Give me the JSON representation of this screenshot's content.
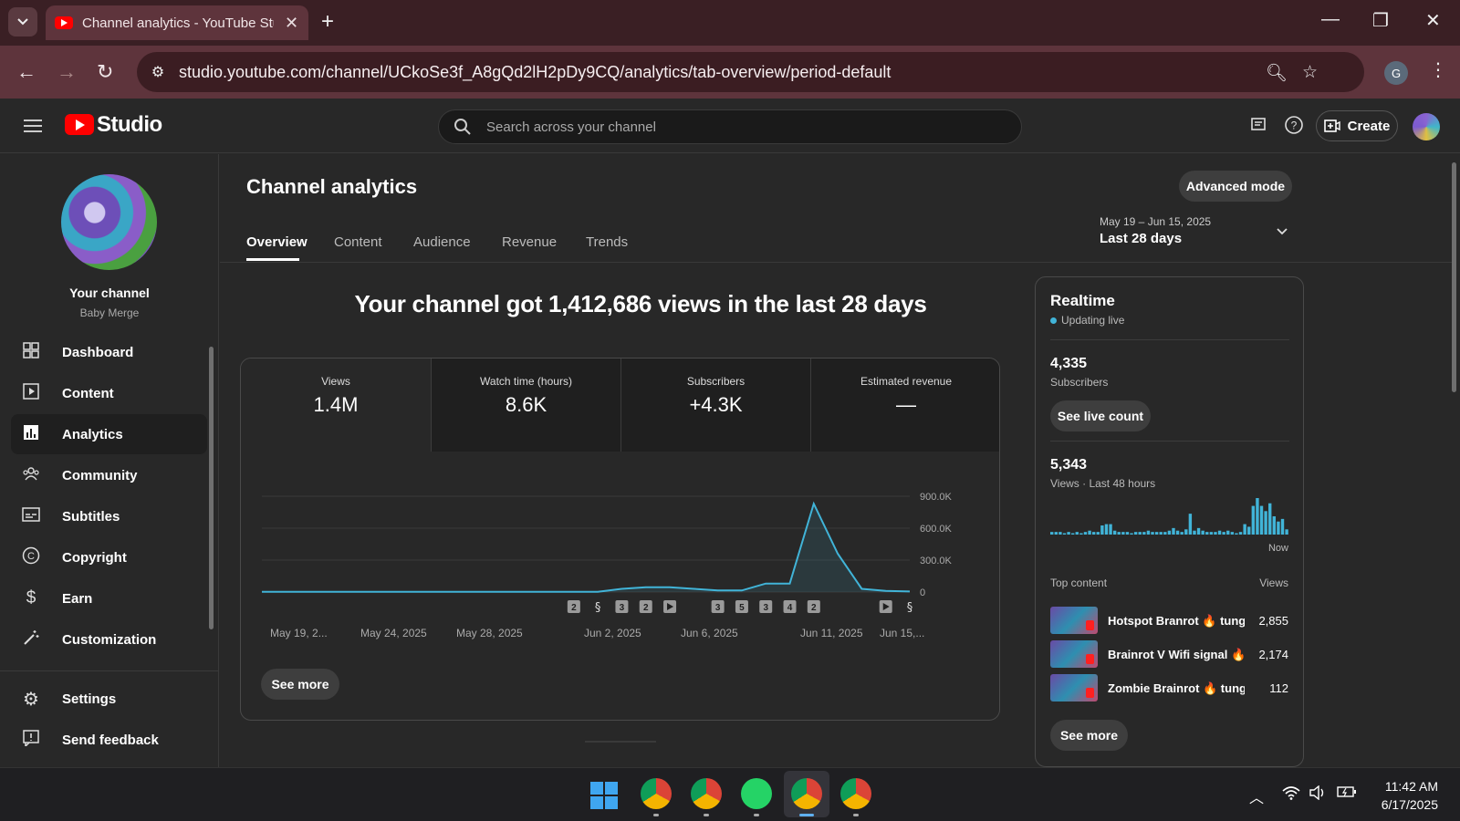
{
  "browser": {
    "tab_title": "Channel analytics - YouTube Studio",
    "url": "studio.youtube.com/channel/UCkoSe3f_A8gQd2lH2pDy9CQ/analytics/tab-overview/period-default",
    "profile_initial": "G"
  },
  "studio": {
    "logo_text": "Studio",
    "search_placeholder": "Search across your channel",
    "create_label": "Create"
  },
  "sidebar": {
    "channel_title": "Your channel",
    "channel_name": "Baby Merge",
    "items": [
      {
        "label": "Dashboard",
        "icon": "dashboard-icon"
      },
      {
        "label": "Content",
        "icon": "content-icon"
      },
      {
        "label": "Analytics",
        "icon": "analytics-icon",
        "active": true
      },
      {
        "label": "Community",
        "icon": "community-icon"
      },
      {
        "label": "Subtitles",
        "icon": "subtitles-icon"
      },
      {
        "label": "Copyright",
        "icon": "copyright-icon"
      },
      {
        "label": "Earn",
        "icon": "earn-icon"
      },
      {
        "label": "Customization",
        "icon": "customization-icon"
      }
    ],
    "bottom_items": [
      {
        "label": "Settings",
        "icon": "settings-icon"
      },
      {
        "label": "Send feedback",
        "icon": "feedback-icon"
      }
    ]
  },
  "main": {
    "title": "Channel analytics",
    "advanced_mode": "Advanced mode",
    "tabs": [
      "Overview",
      "Content",
      "Audience",
      "Revenue",
      "Trends"
    ],
    "date_range": "May 19 – Jun 15, 2025",
    "date_period": "Last 28 days",
    "headline": "Your channel got 1,412,686 views in the last 28 days",
    "metrics": [
      {
        "label": "Views",
        "value": "1.4M"
      },
      {
        "label": "Watch time (hours)",
        "value": "8.6K"
      },
      {
        "label": "Subscribers",
        "value": "+4.3K"
      },
      {
        "label": "Estimated revenue",
        "value": "—"
      }
    ],
    "see_more": "See more"
  },
  "chart_data": {
    "type": "line",
    "title": "",
    "y_ticks": [
      "900.0K",
      "600.0K",
      "300.0K",
      "0"
    ],
    "ylim": [
      0,
      900000
    ],
    "x_tick_labels": [
      "May 19, 2...",
      "May 24, 2025",
      "May 28, 2025",
      "Jun 2, 2025",
      "Jun 6, 2025",
      "Jun 11, 2025",
      "Jun 15,..."
    ],
    "series": [
      {
        "values": [
          2000,
          2000,
          2000,
          2000,
          2000,
          2000,
          2000,
          2000,
          2000,
          2000,
          2000,
          2000,
          2000,
          2000,
          2000,
          30000,
          45000,
          45000,
          30000,
          15000,
          15000,
          80000,
          80000,
          830000,
          360000,
          30000,
          10000,
          5000
        ]
      }
    ],
    "markers": [
      {
        "day": 13,
        "label": "2"
      },
      {
        "day": 14,
        "label": "shorts"
      },
      {
        "day": 15,
        "label": "3"
      },
      {
        "day": 16,
        "label": "2"
      },
      {
        "day": 17,
        "label": "play"
      },
      {
        "day": 19,
        "label": "3"
      },
      {
        "day": 20,
        "label": "5"
      },
      {
        "day": 21,
        "label": "3"
      },
      {
        "day": 22,
        "label": "4"
      },
      {
        "day": 23,
        "label": "2"
      },
      {
        "day": 26,
        "label": "play"
      },
      {
        "day": 27,
        "label": "shorts"
      }
    ],
    "grid": true,
    "color": "#41b4d8"
  },
  "realtime": {
    "title": "Realtime",
    "status": "Updating live",
    "subscribers_value": "4,335",
    "subscribers_label": "Subscribers",
    "see_live_count": "See live count",
    "views_value": "5,343",
    "views_label": "Views · Last 48 hours",
    "now_label": "Now",
    "bars": [
      2,
      2,
      2,
      1,
      2,
      1,
      2,
      1,
      2,
      3,
      2,
      2,
      7,
      8,
      8,
      3,
      2,
      2,
      2,
      1,
      2,
      2,
      2,
      3,
      2,
      2,
      2,
      2,
      3,
      5,
      3,
      2,
      4,
      16,
      3,
      5,
      3,
      2,
      2,
      2,
      3,
      2,
      3,
      2,
      1,
      2,
      8,
      6,
      22,
      28,
      22,
      18,
      24,
      14,
      10,
      12,
      4
    ],
    "top_content_label": "Top content",
    "views_col": "Views",
    "top_content": [
      {
        "title": "Hotspot Branrot 🔥 tung tung",
        "views": "2,855"
      },
      {
        "title": "Brainrot V Wifi signal 🔥 Lirili",
        "views": "2,174"
      },
      {
        "title": "Zombie Brainrot 🔥 tung tung",
        "views": "112"
      }
    ],
    "see_more": "See more"
  },
  "taskbar": {
    "time": "11:42 AM",
    "date": "6/17/2025"
  }
}
